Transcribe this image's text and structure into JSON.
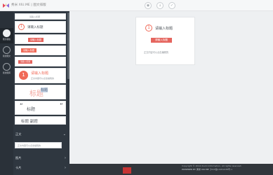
{
  "app": {
    "title": "秀米 XIU.ME",
    "subtitle": "图文排版"
  },
  "sidebar": {
    "items": [
      {
        "label": "图文模板",
        "icon": "document-icon"
      },
      {
        "label": "我的图文",
        "icon": "edit-icon"
      },
      {
        "label": "我的图库",
        "icon": "image-icon"
      }
    ]
  },
  "styles": {
    "title_text": "请输入标题",
    "body_text": "正文内容可以点击编辑的",
    "small_caption": "请输入标题",
    "number": "1",
    "banner_text": "请输入标题",
    "big_title": "标题",
    "title_label": "标题",
    "banner2": "请输入标题",
    "title_quote": "标题",
    "title_title": "标题 副题"
  },
  "sections": {
    "text": "正文",
    "image": "图片",
    "card": "卡片",
    "layout": "布局"
  },
  "text_input": {
    "placeholder": "正文内容可以点击编辑的"
  },
  "canvas": {
    "number": "1",
    "title": "请输入标题",
    "banner": "请输入标题",
    "body": "正文内容可以点击编辑的"
  },
  "footer": {
    "line1": "Copyright © 2014 Xiumi Information. All rights reserved.",
    "line2": "POWERED BY 秀米 XIU.ME",
    "icp": "沪ICP备14051638号-1"
  },
  "colors": {
    "accent": "#e5655e",
    "accent_dark": "#c94d48"
  }
}
